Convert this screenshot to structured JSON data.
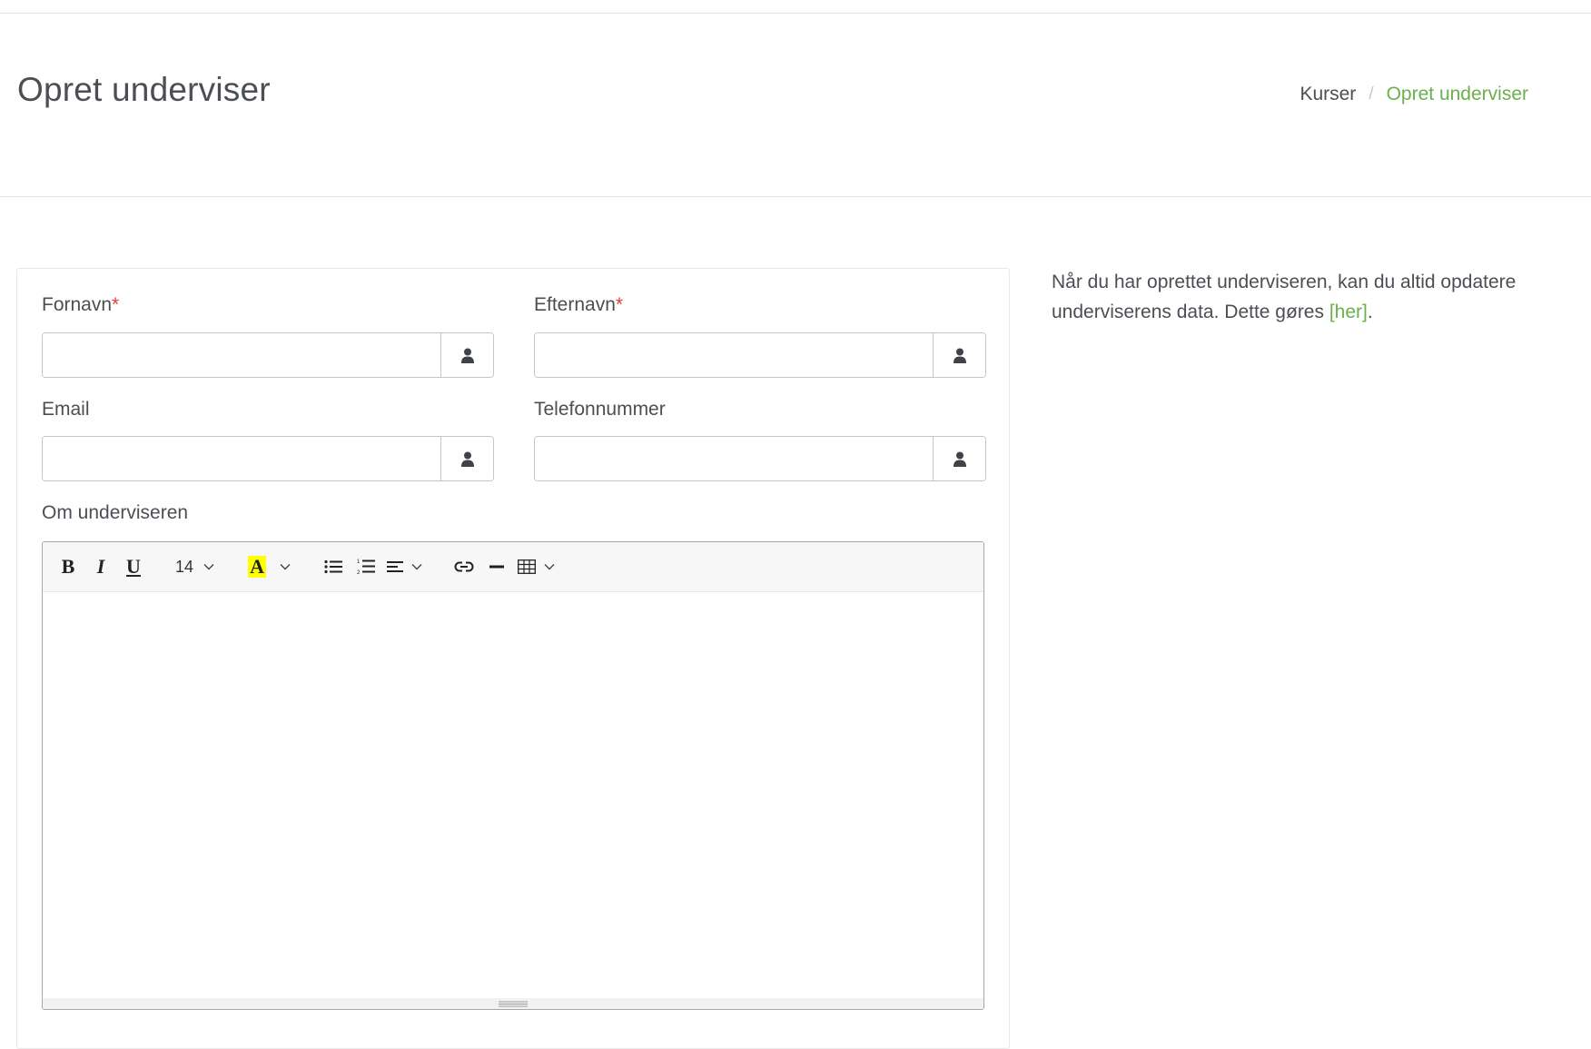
{
  "page": {
    "title": "Opret underviser"
  },
  "breadcrumb": {
    "items": [
      {
        "label": "Kurser"
      },
      {
        "separator": "/"
      },
      {
        "label": "Opret underviser"
      }
    ]
  },
  "form": {
    "first_name": {
      "label": "Fornavn",
      "required_mark": "*",
      "value": "",
      "icon": "user-icon"
    },
    "last_name": {
      "label": "Efternavn",
      "required_mark": "*",
      "value": "",
      "icon": "user-icon"
    },
    "email": {
      "label": "Email",
      "value": "",
      "icon": "user-icon"
    },
    "phone": {
      "label": "Telefonnummer",
      "value": "",
      "icon": "user-icon"
    },
    "about": {
      "label": "Om underviseren",
      "toolbar": {
        "bold": "B",
        "italic": "I",
        "underline": "U",
        "font_size": "14",
        "highlight": "A",
        "highlight_color": "#ffff00"
      }
    }
  },
  "side_note": {
    "text": "Når du har oprettet underviseren, kan du altid opdatere underviserens data. Dette gøres ",
    "link": "[her]",
    "end": "."
  },
  "colors": {
    "accent": "#6ab04c",
    "required": "#e53935",
    "text": "#4b4f53"
  }
}
